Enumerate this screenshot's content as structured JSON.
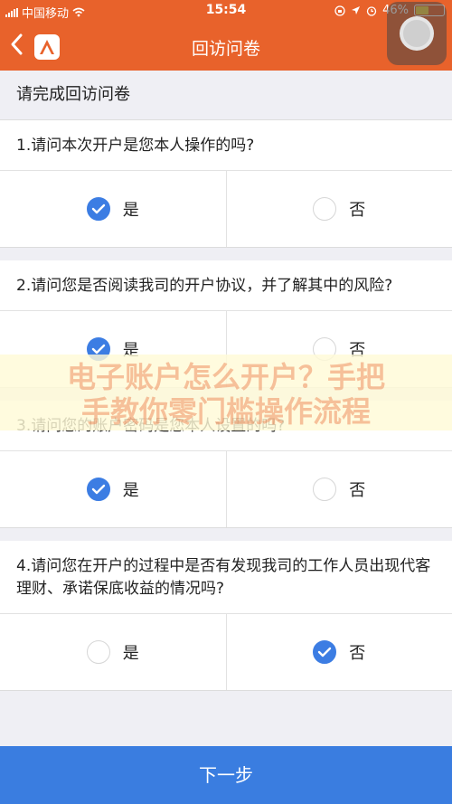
{
  "status_bar": {
    "carrier": "中国移动",
    "time": "15:54",
    "battery_percent": "46%"
  },
  "nav": {
    "title": "回访问卷"
  },
  "section_title": "请完成回访问卷",
  "questions": [
    {
      "text": "1.请问本次开户是您本人操作的吗?",
      "options": [
        {
          "label": "是",
          "checked": true
        },
        {
          "label": "否",
          "checked": false
        }
      ]
    },
    {
      "text": "2.请问您是否阅读我司的开户协议，并了解其中的风险?",
      "options": [
        {
          "label": "是",
          "checked": true
        },
        {
          "label": "否",
          "checked": false
        }
      ]
    },
    {
      "text": "3.请问您的账户密码是您本人设置的吗?",
      "options": [
        {
          "label": "是",
          "checked": true
        },
        {
          "label": "否",
          "checked": false
        }
      ]
    },
    {
      "text": "4.请问您在开户的过程中是否有发现我司的工作人员出现代客理财、承诺保底收益的情况吗?",
      "options": [
        {
          "label": "是",
          "checked": false
        },
        {
          "label": "否",
          "checked": true
        }
      ]
    }
  ],
  "watermark": {
    "line1": "电子账户怎么开户？手把",
    "line2": "手教你零门槛操作流程"
  },
  "next_button": "下一步",
  "colors": {
    "header": "#e8622b",
    "accent": "#3a7de0"
  }
}
